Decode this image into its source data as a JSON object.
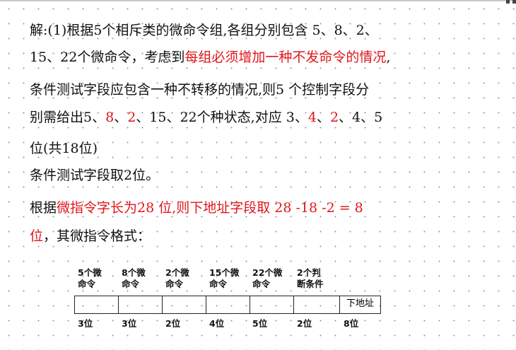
{
  "answer": {
    "line1": {
      "a": "解:(1)根据5个相斥类的微命令组,各组分别包含 5、8、2、"
    },
    "line2": {
      "a": "15、22个微命令，考虑到",
      "b_red": "每组必须增加一种不发命令的情况",
      "c": ","
    },
    "line3": {
      "a": "条件测试字段应包含一种不转移的情况,则5 个控制字段分"
    },
    "line4": {
      "a": "别需给出5、",
      "b_red": "8",
      "c": "、",
      "d_red": "2",
      "e": "、15、22个种状态,对应 3、",
      "f_red": "4",
      "g": "、",
      "h_red": "2",
      "i": "、4、5"
    },
    "line5": {
      "a": "位(共18位)"
    },
    "line6": {
      "a": "条件测试字段取2位。"
    },
    "line7": {
      "a": "根据",
      "b_red": "微指令字长为28 位,则下地址字段取 28 -18 -2 = 8"
    },
    "line8": {
      "a_red": "位",
      "b": "，其微指令格式："
    }
  },
  "format": {
    "fields": [
      {
        "label_top": "5个微",
        "label_bottom": "命令",
        "cell_text": "",
        "bits": "3位"
      },
      {
        "label_top": "8个微",
        "label_bottom": "命令",
        "cell_text": "",
        "bits": "3位"
      },
      {
        "label_top": "2个微",
        "label_bottom": "命令",
        "cell_text": "",
        "bits": "2位"
      },
      {
        "label_top": "15个微",
        "label_bottom": "命令",
        "cell_text": "",
        "bits": "4位"
      },
      {
        "label_top": "22个微",
        "label_bottom": "命令",
        "cell_text": "",
        "bits": "5位"
      },
      {
        "label_top": "2个判",
        "label_bottom": "断条件",
        "cell_text": "",
        "bits": "2位"
      },
      {
        "label_top": "",
        "label_bottom": "",
        "cell_text": "下地址",
        "bits": "8位"
      }
    ]
  }
}
